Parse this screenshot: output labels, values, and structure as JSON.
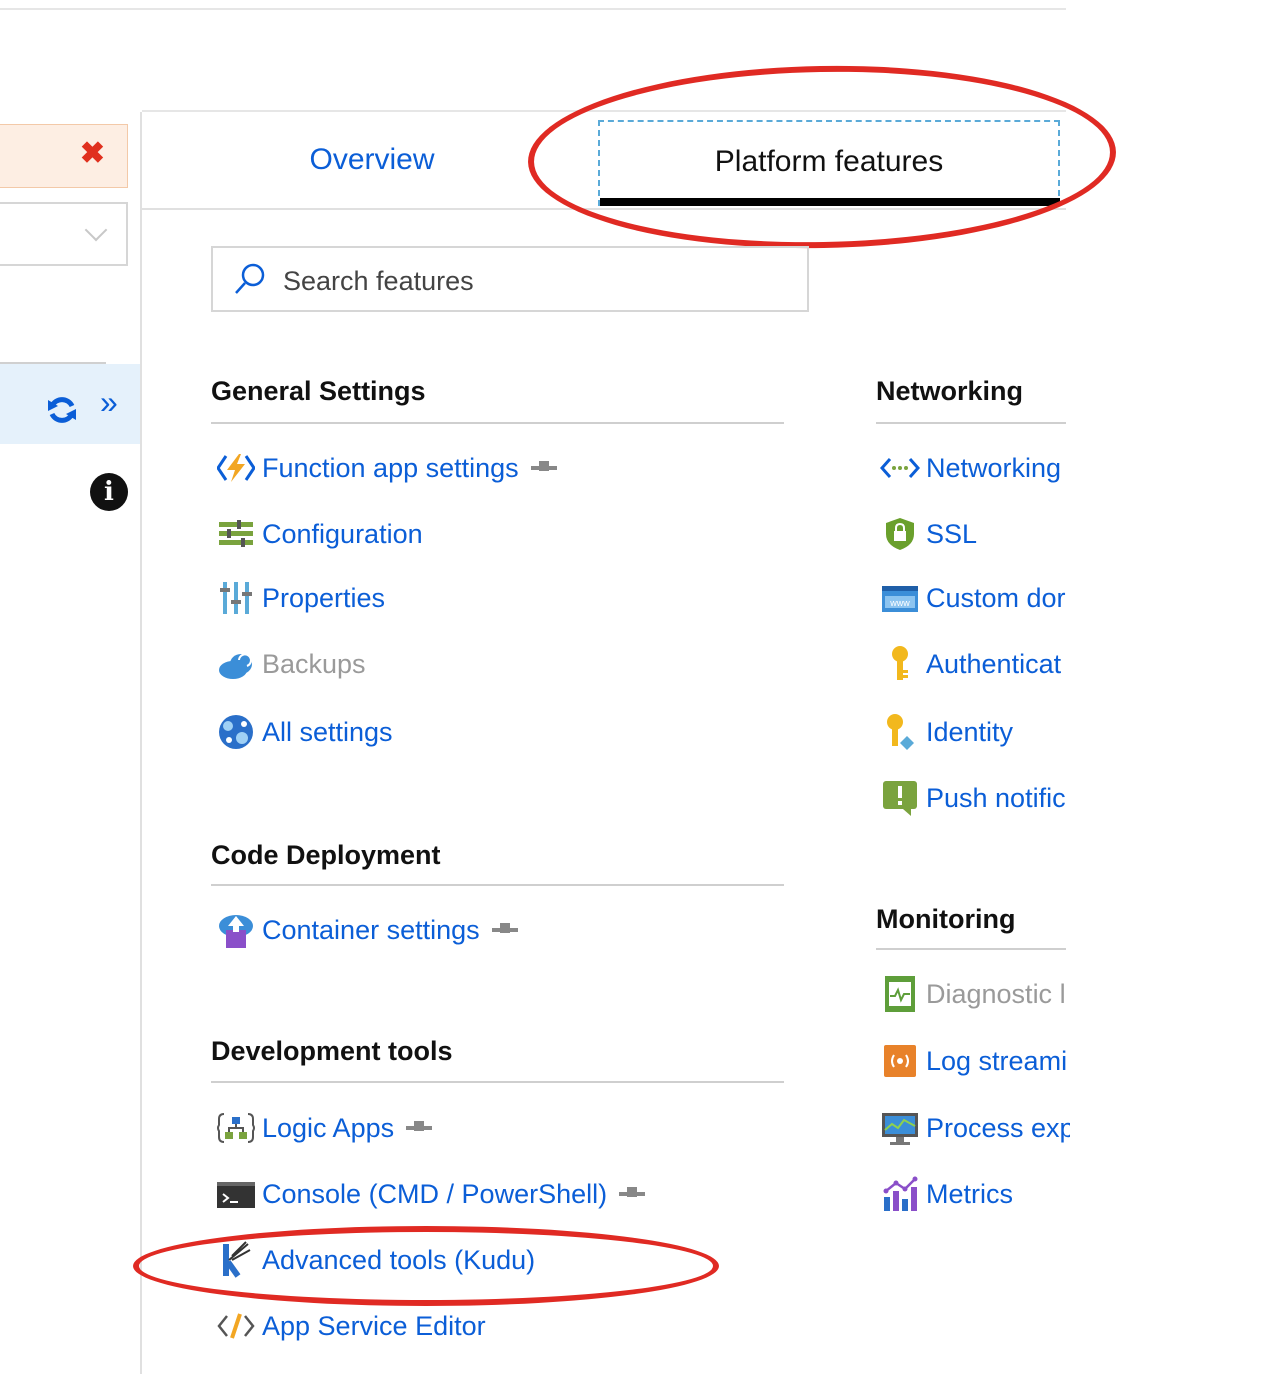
{
  "tabs": {
    "overview": "Overview",
    "platform": "Platform features"
  },
  "search": {
    "placeholder": "Search features"
  },
  "left_panel": {
    "close_symbol": "✖",
    "expand_symbol": "»",
    "info_symbol": "i"
  },
  "sections": {
    "general": {
      "title": "General Settings",
      "items": [
        "Function app settings",
        "Configuration",
        "Properties",
        "Backups",
        "All settings"
      ]
    },
    "code_deployment": {
      "title": "Code Deployment",
      "items": [
        "Container settings"
      ]
    },
    "development_tools": {
      "title": "Development tools",
      "items": [
        "Logic Apps",
        "Console (CMD / PowerShell)",
        "Advanced tools (Kudu)",
        "App Service Editor"
      ]
    },
    "networking": {
      "title": "Networking",
      "items": [
        "Networking",
        "SSL",
        "Custom dor",
        "Authenticat",
        "Identity",
        "Push notific"
      ]
    },
    "monitoring": {
      "title": "Monitoring",
      "items": [
        "Diagnostic l",
        "Log streami",
        "Process exp",
        "Metrics"
      ]
    }
  },
  "colors": {
    "link": "#0b5ed7",
    "highlight_ellipse": "#e02a23",
    "error_bg": "#fdeee3",
    "selected_row": "#e5f1fb"
  }
}
